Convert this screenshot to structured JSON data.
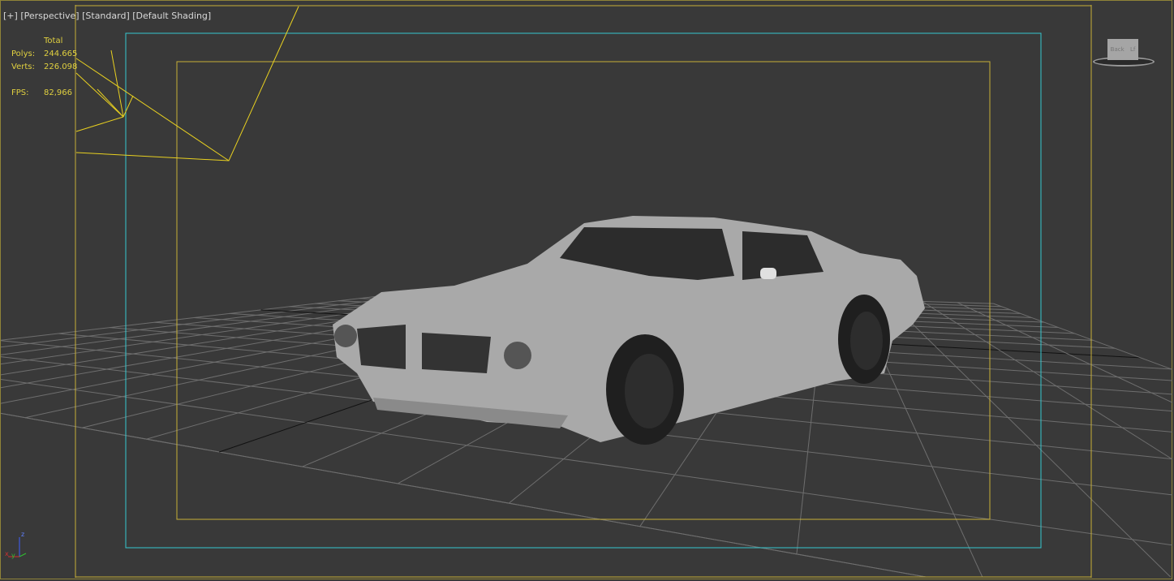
{
  "viewport": {
    "menu_plus": "[+]",
    "view_name": "[Perspective]",
    "render_mode": "[Standard]",
    "shading": "[Default Shading]"
  },
  "stats": {
    "header": "Total",
    "polys_label": "Polys:",
    "polys_value": "244.665",
    "verts_label": "Verts:",
    "verts_value": "226.098",
    "fps_label": "FPS:",
    "fps_value": "82,966"
  },
  "viewcube": {
    "face_back": "Back",
    "face_left": "Lf"
  },
  "axis": {
    "x": "x",
    "y": "y",
    "z": "z"
  },
  "colors": {
    "background": "#393939",
    "safe_frame_yellow": "#c8b038",
    "safe_frame_cyan": "#35c8d0",
    "grid": "#6e6e6e",
    "car": "#a8a8a8"
  }
}
